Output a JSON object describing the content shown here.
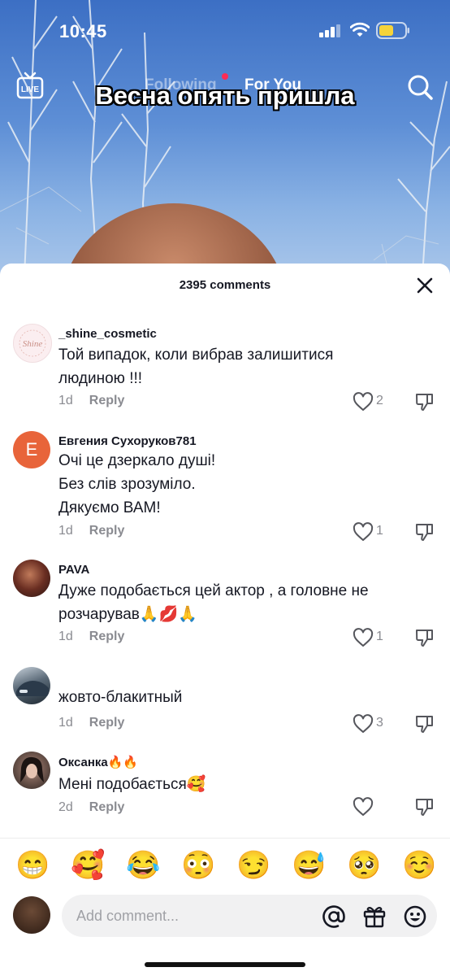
{
  "status_bar": {
    "time": "10:45"
  },
  "video": {
    "live_label": "LIVE",
    "tabs": [
      {
        "label": "Following"
      },
      {
        "label": "For You"
      }
    ],
    "caption": "Весна опять пришла"
  },
  "comments_panel": {
    "count_label": "2395 comments",
    "comments": [
      {
        "username": "_shine_cosmetic",
        "avatar_text": "Shine",
        "text": "Той випадок, коли вибрав залишитися людиною !!!",
        "age": "1d",
        "reply": "Reply",
        "likes": "2"
      },
      {
        "username": "Евгения Сухоруков781",
        "avatar_text": "E",
        "text": "Очі це дзеркало душі!\nБез слів зрозуміло.\nДякуємо ВАМ!",
        "age": "1d",
        "reply": "Reply",
        "likes": "1"
      },
      {
        "username": "PAVA",
        "text": "Дуже подобається цей актор , а головне не розчарував🙏💋🙏",
        "age": "1d",
        "reply": "Reply",
        "likes": "1"
      },
      {
        "username": "",
        "text": "жовто-блакитный",
        "age": "1d",
        "reply": "Reply",
        "likes": "3"
      },
      {
        "username": "Оксанка🔥🔥",
        "text": "Мені подобається🥰",
        "age": "2d",
        "reply": "Reply",
        "likes": ""
      }
    ]
  },
  "emoji_bar": [
    "😁",
    "🥰",
    "😂",
    "😳",
    "😏",
    "😅",
    "🥺",
    "☺️"
  ],
  "input": {
    "placeholder": "Add comment..."
  },
  "colors": {
    "accent": "#fe2c55",
    "avatar_e": "#e8643a"
  }
}
